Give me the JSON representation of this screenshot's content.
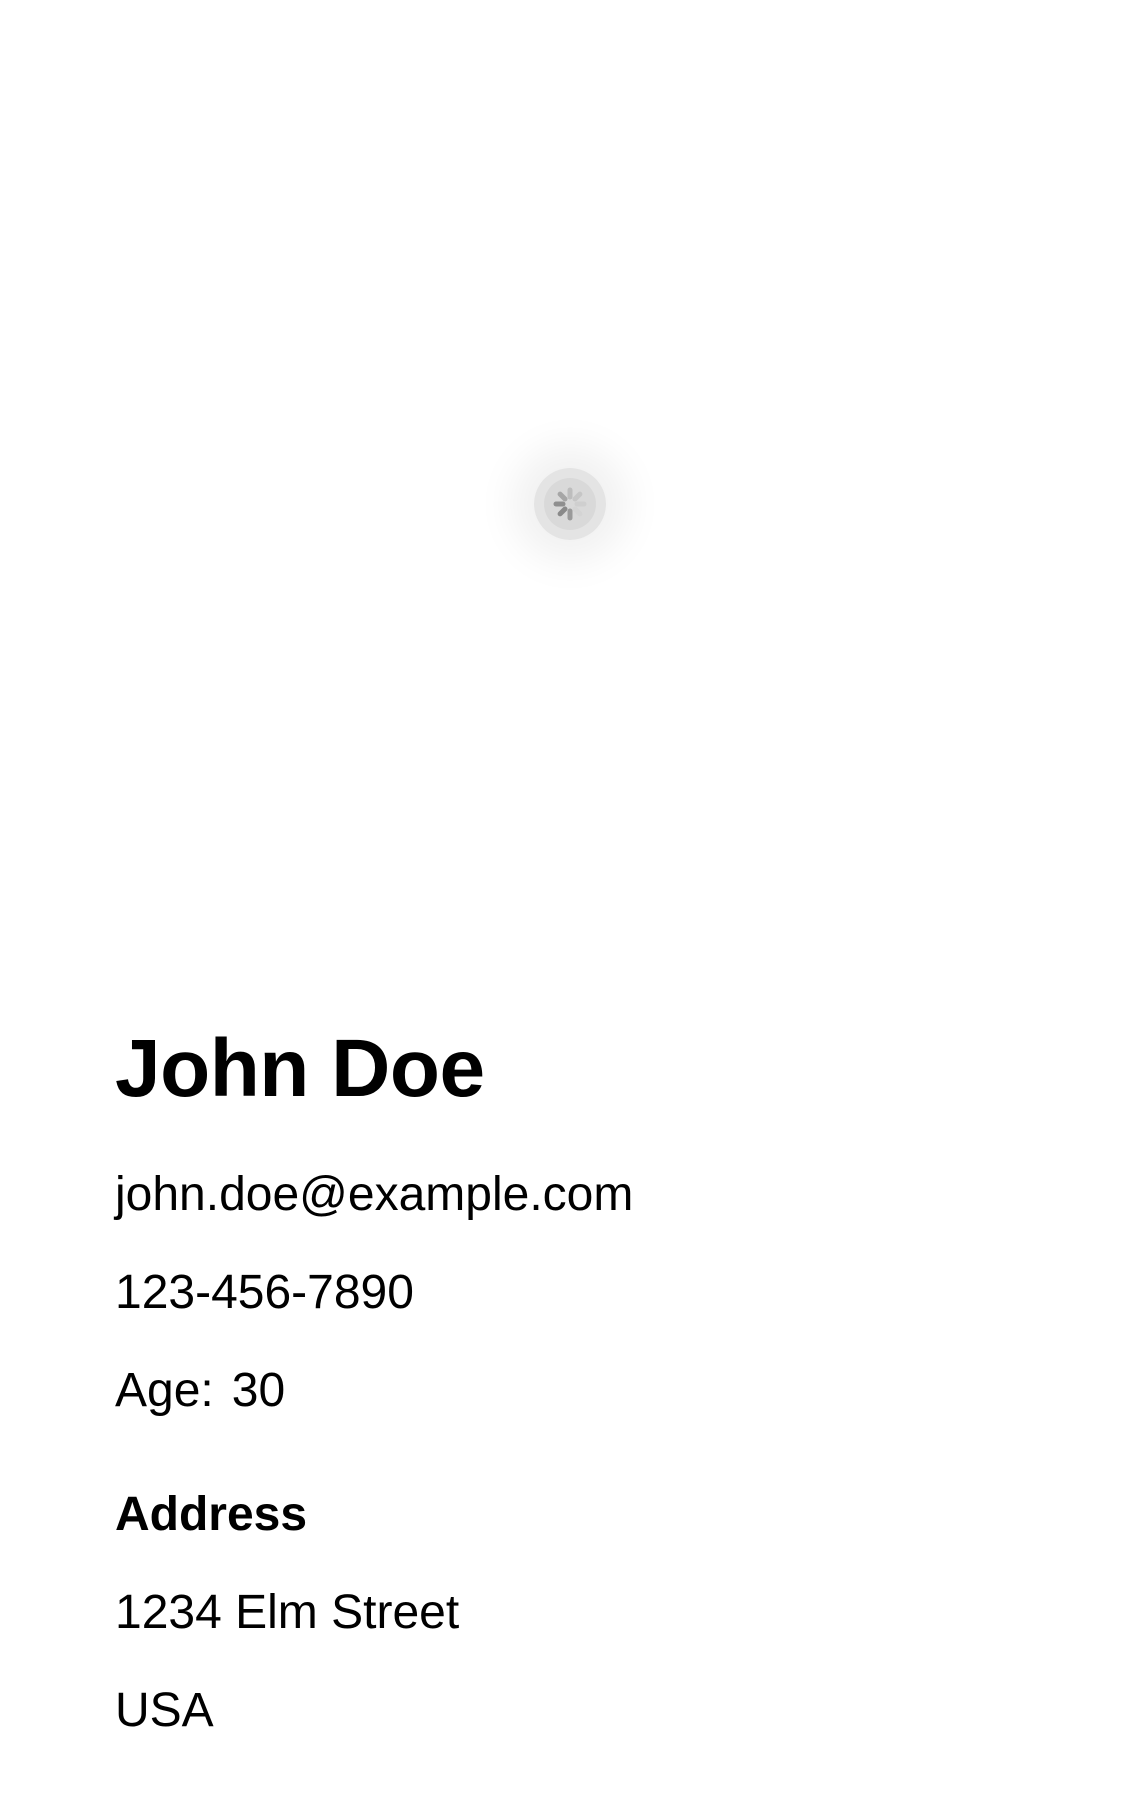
{
  "loader": {
    "icon": "loading-spinner-icon",
    "colors": {
      "ring": "#e4e4e4",
      "spokes": "#8a8a8a"
    }
  },
  "profile": {
    "name": "John Doe",
    "email": "john.doe@example.com",
    "phone": "123-456-7890",
    "age_label": "Age:",
    "age_value": "30",
    "address_heading": "Address",
    "address_street": "1234 Elm Street",
    "address_country": "USA"
  }
}
